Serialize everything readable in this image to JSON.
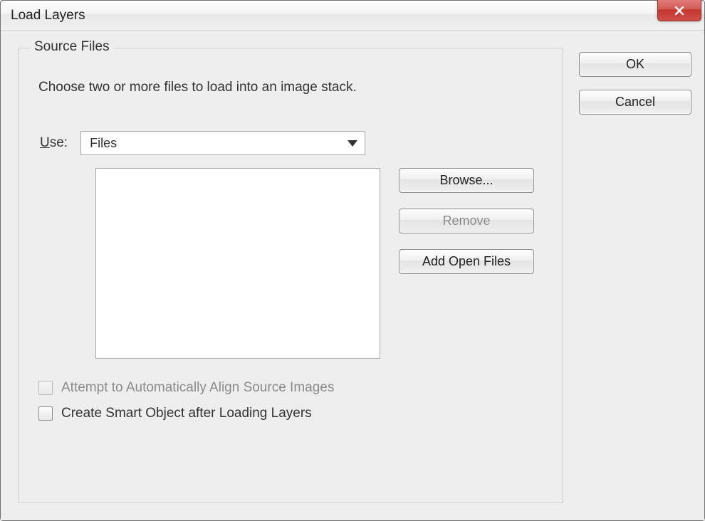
{
  "window": {
    "title": "Load Layers"
  },
  "source_files": {
    "legend": "Source Files",
    "instructions": "Choose two or more files to load into an image stack.",
    "use_label_prefix": "U",
    "use_label_rest": "se:",
    "use_value": "Files",
    "browse_label": "Browse...",
    "remove_label": "Remove",
    "add_open_files_label": "Add Open Files",
    "auto_align_label": "Attempt to Automatically Align Source Images",
    "smart_object_label": "Create Smart Object after Loading Layers"
  },
  "actions": {
    "ok_label": "OK",
    "cancel_label": "Cancel"
  }
}
